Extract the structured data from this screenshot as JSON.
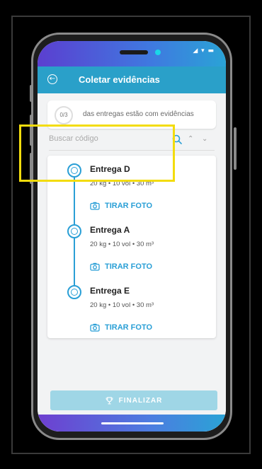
{
  "status_bar": {
    "icons": "◢ ▾ ▬"
  },
  "app_bar": {
    "title": "Coletar evidências",
    "back_icon": "arrow-left-icon"
  },
  "progress": {
    "count": "0/3",
    "text": "das entregas estão com evidências"
  },
  "search": {
    "placeholder": "Buscar código",
    "prev_icon": "chevron-up-icon",
    "next_icon": "chevron-down-icon"
  },
  "deliveries": [
    {
      "name": "Entrega D",
      "meta": "20 kg  •  10 vol  •  30 m³",
      "action": "TIRAR FOTO"
    },
    {
      "name": "Entrega A",
      "meta": "20 kg  •  10 vol  •  30 m³",
      "action": "TIRAR FOTO"
    },
    {
      "name": "Entrega E",
      "meta": "20 kg  •  10 vol  •  30 m³",
      "action": "TIRAR FOTO"
    }
  ],
  "footer": {
    "finalize_label": "FINALIZAR",
    "finalize_icon": "trophy-icon"
  },
  "colors": {
    "accent": "#2aa0c9",
    "highlight": "#f3dc0d",
    "finalize_bg": "#9fd6e6"
  }
}
